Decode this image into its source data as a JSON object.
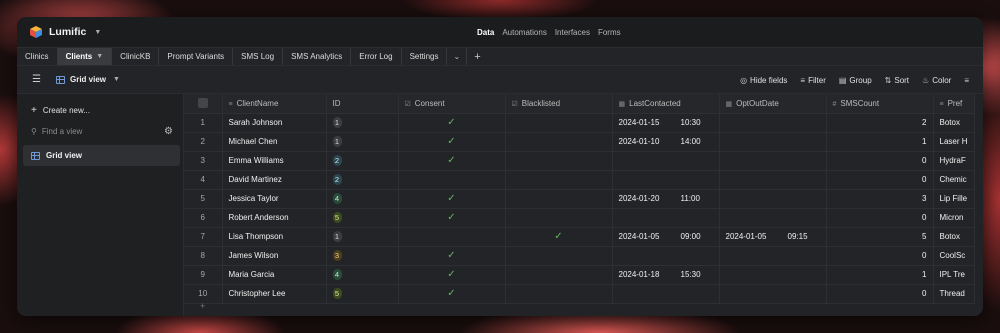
{
  "app": {
    "title": "Lumific"
  },
  "top_nav": [
    "Data",
    "Automations",
    "Interfaces",
    "Forms"
  ],
  "tabs": [
    {
      "label": "Clinics",
      "active": false
    },
    {
      "label": "Clients",
      "active": true
    },
    {
      "label": "ClinicKB",
      "active": false
    },
    {
      "label": "Prompt Variants",
      "active": false
    },
    {
      "label": "SMS Log",
      "active": false
    },
    {
      "label": "SMS Analytics",
      "active": false
    },
    {
      "label": "Error Log",
      "active": false
    },
    {
      "label": "Settings",
      "active": false
    }
  ],
  "toolbar": {
    "view_name": "Grid view",
    "hide_fields": "Hide fields",
    "filter": "Filter",
    "group": "Group",
    "sort": "Sort",
    "color": "Color"
  },
  "sidebar": {
    "create_new": "Create new...",
    "find_placeholder": "Find a view",
    "views": [
      "Grid view"
    ]
  },
  "table": {
    "columns": [
      "ClientName",
      "ID",
      "Consent",
      "Blacklisted",
      "LastContacted",
      "OptOutDate",
      "SMSCount",
      "Pref"
    ],
    "rows": [
      {
        "n": "1",
        "name": "Sarah Johnson",
        "id": "1",
        "consent": true,
        "black": false,
        "lc_date": "2024-01-15",
        "lc_time": "10:30",
        "oo_date": "",
        "oo_time": "",
        "sms": "2",
        "pref": "Botox"
      },
      {
        "n": "2",
        "name": "Michael Chen",
        "id": "1",
        "consent": true,
        "black": false,
        "lc_date": "2024-01-10",
        "lc_time": "14:00",
        "oo_date": "",
        "oo_time": "",
        "sms": "1",
        "pref": "Laser H"
      },
      {
        "n": "3",
        "name": "Emma Williams",
        "id": "2",
        "consent": true,
        "black": false,
        "lc_date": "",
        "lc_time": "",
        "oo_date": "",
        "oo_time": "",
        "sms": "0",
        "pref": "HydraF"
      },
      {
        "n": "4",
        "name": "David Martinez",
        "id": "2",
        "consent": false,
        "black": false,
        "lc_date": "",
        "lc_time": "",
        "oo_date": "",
        "oo_time": "",
        "sms": "0",
        "pref": "Chemic"
      },
      {
        "n": "5",
        "name": "Jessica Taylor",
        "id": "4",
        "consent": true,
        "black": false,
        "lc_date": "2024-01-20",
        "lc_time": "11:00",
        "oo_date": "",
        "oo_time": "",
        "sms": "3",
        "pref": "Lip Fille"
      },
      {
        "n": "6",
        "name": "Robert Anderson",
        "id": "5",
        "consent": true,
        "black": false,
        "lc_date": "",
        "lc_time": "",
        "oo_date": "",
        "oo_time": "",
        "sms": "0",
        "pref": "Micron"
      },
      {
        "n": "7",
        "name": "Lisa Thompson",
        "id": "1",
        "consent": false,
        "black": true,
        "lc_date": "2024-01-05",
        "lc_time": "09:00",
        "oo_date": "2024-01-05",
        "oo_time": "09:15",
        "sms": "5",
        "pref": "Botox"
      },
      {
        "n": "8",
        "name": "James Wilson",
        "id": "3",
        "consent": true,
        "black": false,
        "lc_date": "",
        "lc_time": "",
        "oo_date": "",
        "oo_time": "",
        "sms": "0",
        "pref": "CoolSc"
      },
      {
        "n": "9",
        "name": "Maria Garcia",
        "id": "4",
        "consent": true,
        "black": false,
        "lc_date": "2024-01-18",
        "lc_time": "15:30",
        "oo_date": "",
        "oo_time": "",
        "sms": "1",
        "pref": "IPL Tre"
      },
      {
        "n": "10",
        "name": "Christopher Lee",
        "id": "5",
        "consent": true,
        "black": false,
        "lc_date": "",
        "lc_time": "",
        "oo_date": "",
        "oo_time": "",
        "sms": "0",
        "pref": "Thread"
      }
    ]
  },
  "colors": {
    "accent_check": "#5fb85f",
    "grid_icon": "#6e9bd8"
  }
}
